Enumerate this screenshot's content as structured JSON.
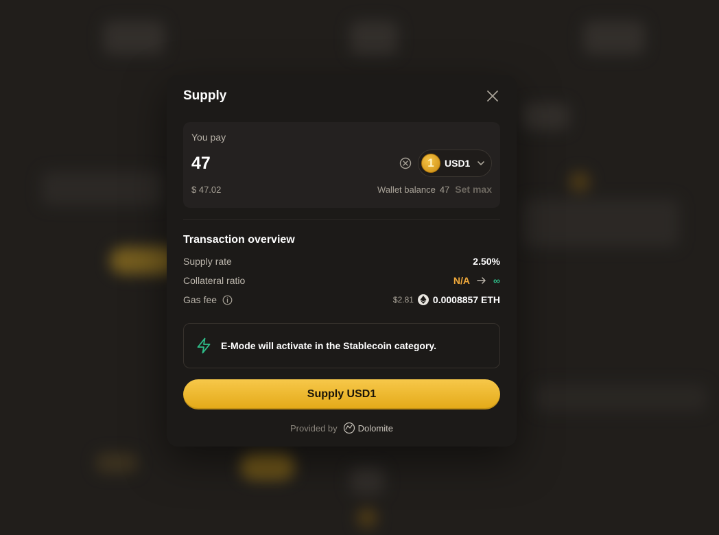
{
  "modal": {
    "title": "Supply"
  },
  "pay": {
    "label": "You pay",
    "amount": "47",
    "usd_value": "$ 47.02",
    "token": {
      "symbol": "USD1",
      "icon_glyph": "1",
      "icon_color": "#f0b42a"
    },
    "wallet_label": "Wallet balance",
    "wallet_balance": "47",
    "set_max_label": "Set max"
  },
  "overview": {
    "title": "Transaction overview",
    "supply_rate": {
      "label": "Supply rate",
      "value": "2.50%"
    },
    "collateral_ratio": {
      "label": "Collateral ratio",
      "from": "N/A",
      "to": "∞"
    },
    "gas_fee": {
      "label": "Gas fee",
      "usd": "$2.81",
      "value": "0.0008857 ETH"
    }
  },
  "emode": {
    "message": "E-Mode will activate in the Stablecoin category.",
    "icon": "lightning-icon"
  },
  "actions": {
    "supply_label": "Supply USD1"
  },
  "footer": {
    "provided_by": "Provided by",
    "provider": "Dolomite"
  },
  "colors": {
    "accent": "#f0b42a",
    "warning": "#f0a93b",
    "success": "#2fbf8a",
    "surface": "#1c1a18"
  }
}
